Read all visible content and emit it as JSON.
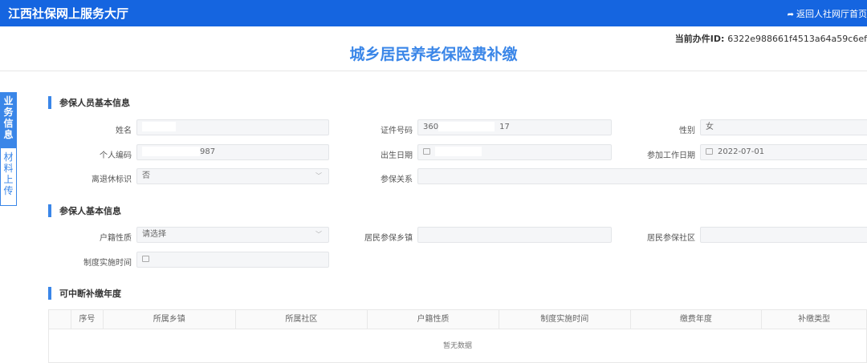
{
  "header": {
    "title": "江西社保网上服务大厅",
    "back_link": "返回人社网厅首页",
    "back_icon": "back-arrow-icon"
  },
  "case": {
    "label": "当前办件ID:",
    "value": "6322e988661f4513a64a59c6ef"
  },
  "page": {
    "title": "城乡居民养老保险费补缴"
  },
  "side_tabs": [
    {
      "label": "业务信息",
      "active": true
    },
    {
      "label": "材料上传",
      "active": false
    }
  ],
  "section1": {
    "title": "参保人员基本信息",
    "name_label": "姓名",
    "name_value": "",
    "id_label": "证件号码",
    "id_value_prefix": "360",
    "id_value_suffix": "17",
    "gender_label": "性别",
    "gender_value": "女",
    "personal_code_label": "个人编码",
    "personal_code_suffix": "987",
    "birth_label": "出生日期",
    "birth_value": "",
    "work_date_label": "参加工作日期",
    "work_date_value": "2022-07-01",
    "retire_label": "离退休标识",
    "retire_value": "否",
    "relation_label": "参保关系",
    "relation_value": ""
  },
  "section2": {
    "title": "参保人基本信息",
    "household_label": "户籍性质",
    "household_placeholder": "请选择",
    "town_label": "居民参保乡镇",
    "town_value": "",
    "community_label": "居民参保社区",
    "community_value": "",
    "policy_date_label": "制度实施时间",
    "policy_date_value": ""
  },
  "section3": {
    "title": "可中断补缴年度",
    "columns": [
      "序号",
      "所属乡镇",
      "所属社区",
      "户籍性质",
      "制度实施时间",
      "缴费年度",
      "补缴类型"
    ],
    "empty_text": "暂无数据"
  },
  "colors": {
    "brand_blue": "#1565e0",
    "accent_blue": "#3a86e8"
  }
}
